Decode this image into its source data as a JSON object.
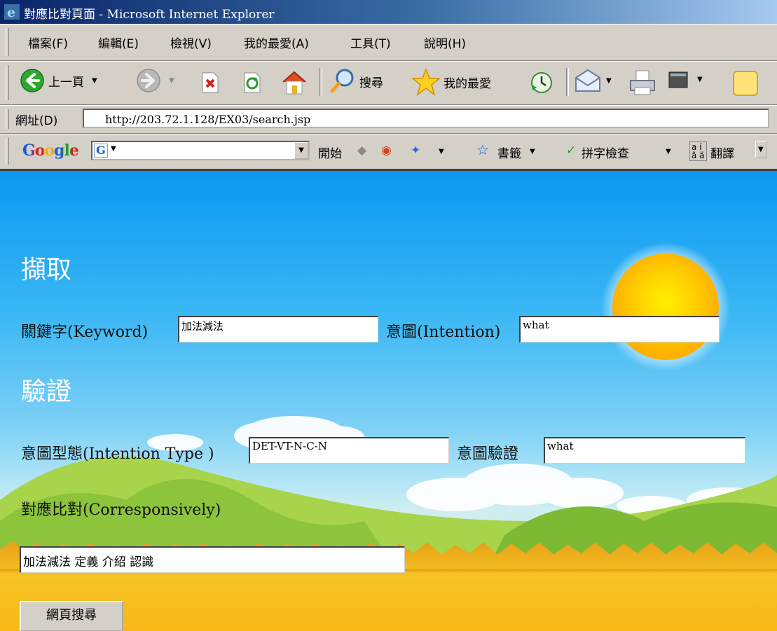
{
  "window": {
    "title": "對應比對頁面 - Microsoft Internet Explorer"
  },
  "menu": [
    "檔案(F)",
    "編輯(E)",
    "檢視(V)",
    "我的最愛(A)",
    "工具(T)",
    "說明(H)"
  ],
  "toolbar": {
    "back": "上一頁",
    "search": "搜尋",
    "favorites": "我的最愛"
  },
  "address": {
    "label": "網址(D)",
    "url": "http://203.72.1.128/EX03/search.jsp"
  },
  "google_bar": {
    "logo": "Google",
    "start": "開始",
    "bookmarks": "書籤",
    "spellcheck": "拼字檢查",
    "translate": "翻譯"
  },
  "page": {
    "capture_heading": "擷取",
    "keyword_label": "關鍵字(Keyword)",
    "keyword_value": "加法減法",
    "intention_label": "意圖(Intention)",
    "intention_value": "what",
    "verify_heading": "驗證",
    "intention_type_label": "意圖型態(Intention Type )",
    "intention_type_value": "DET-VT-N-C-N",
    "intention_verify_label": "意圖驗證",
    "intention_verify_value": "what",
    "corresp_label": "對應比對(Corresponsively)",
    "corresp_value": "加法減法 定義 介紹 認識",
    "submit_label": "網頁搜尋"
  },
  "colors": {
    "sky_top": "#0c98f0",
    "grass": "#f0b814",
    "hills": "#8cc43c",
    "sun": "#ffd000"
  },
  "icons": [
    "ie-logo-icon",
    "back-arrow-icon",
    "forward-arrow-icon",
    "stop-icon",
    "refresh-icon",
    "home-icon",
    "search-icon",
    "favorites-star-icon",
    "history-icon",
    "mail-icon",
    "print-icon",
    "edit-icon",
    "messenger-icon"
  ]
}
